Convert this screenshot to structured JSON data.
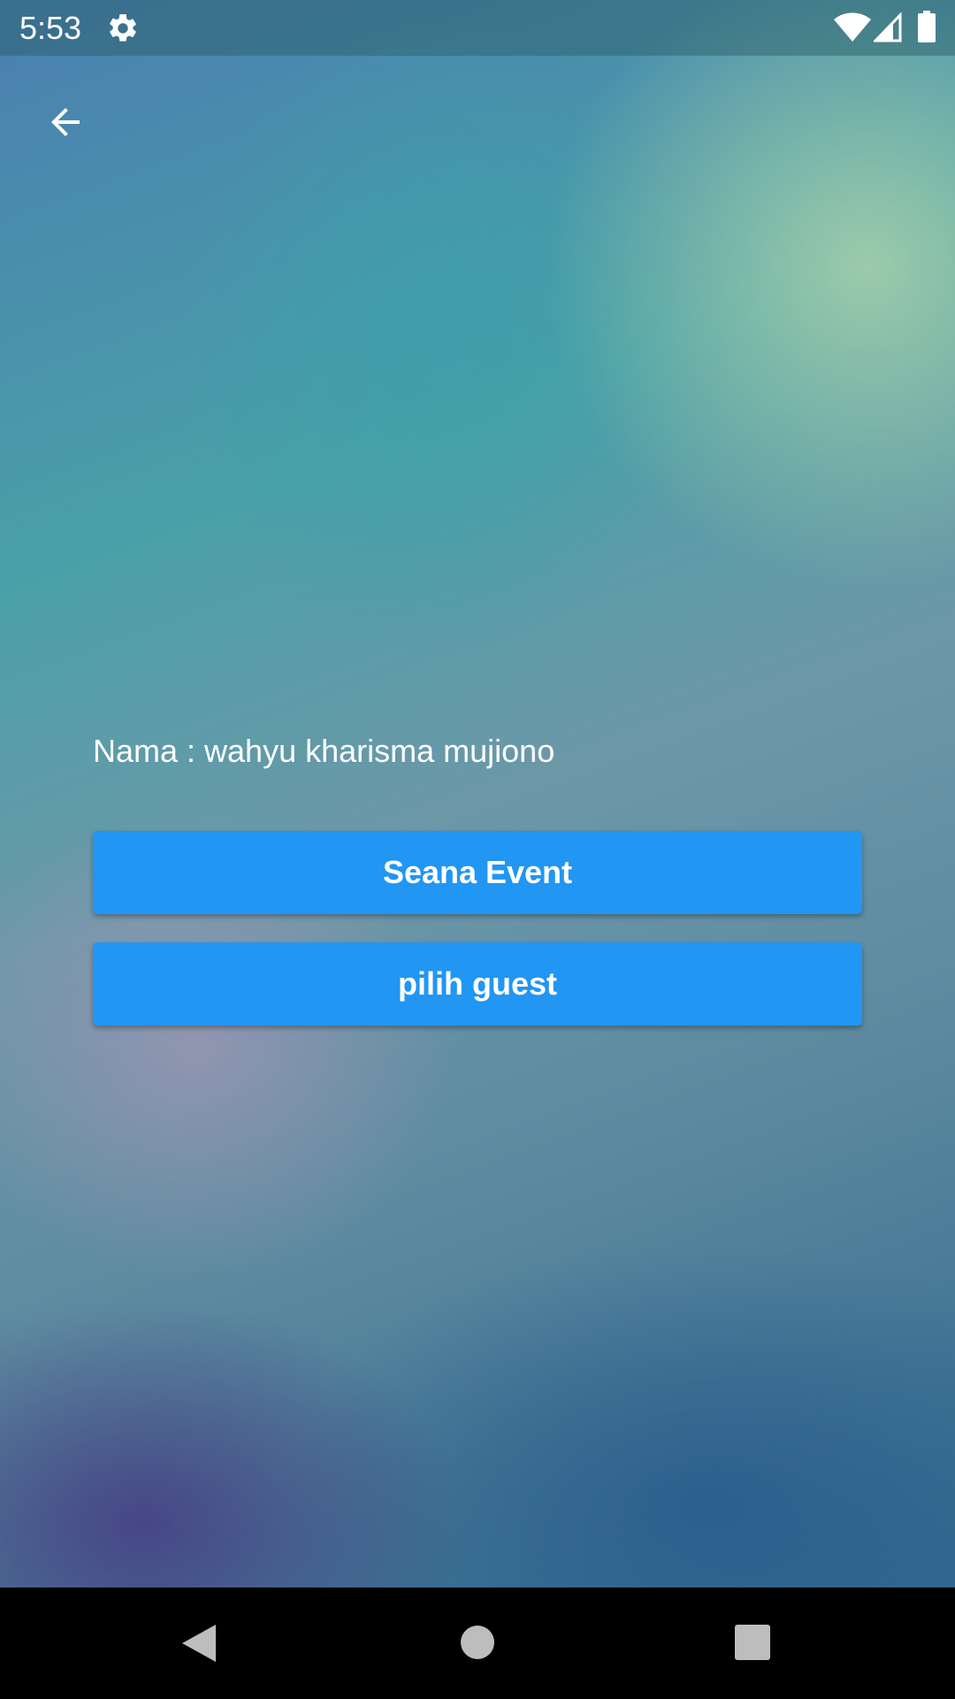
{
  "status_bar": {
    "time": "5:53",
    "icons": [
      "gear-icon",
      "wifi-icon",
      "signal-icon",
      "battery-icon"
    ]
  },
  "header": {
    "back_icon": "arrow-left-icon"
  },
  "main": {
    "name_line": "Nama : wahyu kharisma mujiono",
    "buttons": {
      "event_label": "Seana Event",
      "guest_label": "pilih guest"
    }
  },
  "nav_bar": {
    "icons": [
      "nav-back-icon",
      "nav-home-icon",
      "nav-recents-icon"
    ]
  },
  "colors": {
    "button": "#2196f3",
    "text": "#ffffff",
    "nav_bar": "#000000"
  }
}
